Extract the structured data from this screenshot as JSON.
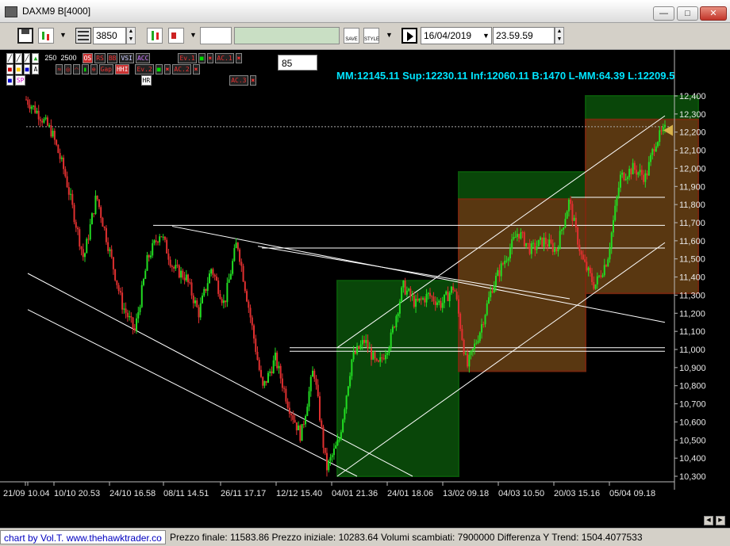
{
  "window": {
    "title": "DAXM9 B[4000]"
  },
  "toolbar": {
    "bars_value": "3850",
    "date_value": "16/04/2019",
    "time_value": "23.59.59",
    "save_icon_label": "SAVE",
    "style_icon_label": "STYLE"
  },
  "indicator_panel": {
    "period_values": [
      "250",
      "2500"
    ],
    "buttons_row1": [
      "OS",
      "RS",
      "BB",
      "VSI",
      "ACC",
      "Ev.1",
      "AC.1"
    ],
    "buttons_row2": [
      "Gap",
      "HHI",
      "Ev.2",
      "AC.2"
    ],
    "buttons_row3": [
      "SP",
      "HR",
      "AC.3"
    ],
    "input_value": "85"
  },
  "chart_header": {
    "stats": "MM:12145.11 Sup:12230.11 Inf:12060.11 B:1470 L-MM:64.39 L:12209.5"
  },
  "chart_data": {
    "type": "candlestick",
    "instrument": "DAXM9",
    "ylim": [
      10300,
      12400
    ],
    "y_ticks": [
      "12,400",
      "12,300",
      "12,200",
      "12,100",
      "12,000",
      "11,900",
      "11,800",
      "11,700",
      "11,600",
      "11,500",
      "11,400",
      "11,300",
      "11,200",
      "11,100",
      "11,000",
      "10,900",
      "10,800",
      "10,700",
      "10,600",
      "10,500",
      "10,400",
      "10,300"
    ],
    "x_ticks": [
      "21/09",
      "10.04",
      "10/10 20.53",
      "24/10 16.58",
      "08/11 14.51",
      "26/11 17.17",
      "12/12 15.40",
      "04/01 21.36",
      "24/01 18.06",
      "13/02 09.18",
      "04/03 10.50",
      "20/03 15.16",
      "05/04 09.18"
    ],
    "last_price": 12209.5,
    "price_path": [
      [
        0,
        12380
      ],
      [
        0.02,
        12300
      ],
      [
        0.04,
        12200
      ],
      [
        0.06,
        11980
      ],
      [
        0.09,
        11500
      ],
      [
        0.11,
        11850
      ],
      [
        0.13,
        11550
      ],
      [
        0.15,
        11250
      ],
      [
        0.17,
        11100
      ],
      [
        0.19,
        11500
      ],
      [
        0.21,
        11650
      ],
      [
        0.23,
        11450
      ],
      [
        0.25,
        11400
      ],
      [
        0.27,
        11200
      ],
      [
        0.29,
        11450
      ],
      [
        0.31,
        11250
      ],
      [
        0.33,
        11600
      ],
      [
        0.35,
        11200
      ],
      [
        0.37,
        10780
      ],
      [
        0.39,
        10950
      ],
      [
        0.41,
        10700
      ],
      [
        0.43,
        10520
      ],
      [
        0.45,
        10900
      ],
      [
        0.47,
        10340
      ],
      [
        0.49,
        10500
      ],
      [
        0.51,
        10950
      ],
      [
        0.53,
        11050
      ],
      [
        0.55,
        10900
      ],
      [
        0.57,
        11050
      ],
      [
        0.59,
        11350
      ],
      [
        0.61,
        11250
      ],
      [
        0.63,
        11300
      ],
      [
        0.65,
        11250
      ],
      [
        0.67,
        11350
      ],
      [
        0.69,
        10900
      ],
      [
        0.71,
        11100
      ],
      [
        0.73,
        11350
      ],
      [
        0.75,
        11500
      ],
      [
        0.77,
        11650
      ],
      [
        0.79,
        11550
      ],
      [
        0.81,
        11600
      ],
      [
        0.83,
        11550
      ],
      [
        0.85,
        11820
      ],
      [
        0.87,
        11500
      ],
      [
        0.89,
        11350
      ],
      [
        0.91,
        11500
      ],
      [
        0.93,
        11950
      ],
      [
        0.95,
        12000
      ],
      [
        0.97,
        11950
      ],
      [
        0.985,
        12150
      ],
      [
        1,
        12209.5
      ]
    ],
    "horizontal_levels": [
      12230.11,
      11840,
      11685,
      11560,
      11010,
      10990
    ],
    "zones": [
      {
        "color": "green",
        "from_date": "04/01",
        "to_date": "13/02",
        "low": 10300,
        "high": 11380
      },
      {
        "color": "green",
        "from_date": "13/02",
        "to_date": "20/03",
        "low": 11830,
        "high": 11980
      },
      {
        "color": "brown",
        "from_date": "13/02",
        "to_date": "20/03",
        "low": 10880,
        "high": 11830
      },
      {
        "color": "green",
        "from_date": "20/03",
        "to_date": "16/04",
        "low": 12270,
        "high": 12400
      },
      {
        "color": "brown",
        "from_date": "20/03",
        "to_date": "16/04",
        "low": 11310,
        "high": 12270
      }
    ]
  },
  "status": {
    "credit": "chart by Vol.T. www.thehawktrader.co",
    "info": "Prezzo finale: 11583.86 Prezzo iniziale: 10283.64 Volumi scambiati: 7900000 Differenza Y Trend: 1504.4077533"
  },
  "colors": {
    "background": "#000000",
    "up": "#22dd22",
    "down": "#e03030",
    "stats_text": "#00e5ff",
    "axis_text": "#e8e8e8"
  }
}
